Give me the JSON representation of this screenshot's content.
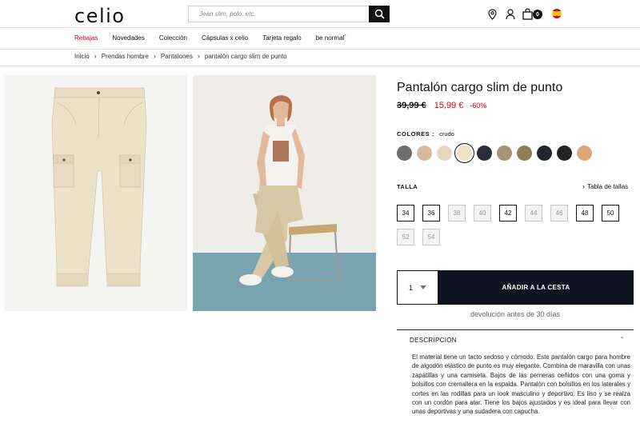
{
  "header": {
    "logo": "celio",
    "search_placeholder": "Jean slim, polo, etc.",
    "cart_count": "0"
  },
  "nav": {
    "items": [
      "Rebajas",
      "Novedades",
      "Colección",
      "Cápsulas x celio",
      "Tarjeta regalo",
      "be normal"
    ],
    "star": "*"
  },
  "breadcrumb": [
    "Inicio",
    "Prendas hombre",
    "Pantalones",
    "pantalón cargo slim de punto"
  ],
  "product": {
    "title": "Pantalón cargo slim de punto",
    "old_price": "39,99 €",
    "new_price": "15,99 €",
    "discount": "-60%",
    "colors_label": "COLORES :",
    "selected_color": "crudo",
    "swatch_colors": [
      "#6e6e6e",
      "#d6b99c",
      "#e8d7bf",
      "#ede4c8",
      "#2b2d3a",
      "#a89472",
      "#8d7f58",
      "#222530",
      "#242424",
      "#d8a878"
    ],
    "size_label": "TALLA",
    "size_guide": "Tabla de tallas",
    "sizes": [
      {
        "label": "34",
        "available": true
      },
      {
        "label": "36",
        "available": true
      },
      {
        "label": "38",
        "available": false
      },
      {
        "label": "40",
        "available": false
      },
      {
        "label": "42",
        "available": true
      },
      {
        "label": "44",
        "available": false
      },
      {
        "label": "46",
        "available": false
      },
      {
        "label": "48",
        "available": true
      },
      {
        "label": "50",
        "available": true
      },
      {
        "label": "52",
        "available": false
      },
      {
        "label": "54",
        "available": false
      }
    ],
    "quantity": "1",
    "add_to_cart": "AÑADIR A LA CESTA",
    "return_note": "devolución antes de 30 días",
    "description_label": "DESCRIPCIÓN",
    "description_toggle": "-",
    "description": "El material tiene un tacto sedoso y cómodo. Este pantalón cargo para hombre de algodón elástico de punto es muy elegante. Combina de maravilla con unas zapatillas y una camiseta. Bajos de las perneras ceñidos con una goma y bolsillos con cremallera en la espalda. Pantalón con bolsillos en los laterales y cortes en las rodillas para un look masculino y deportivo. Es liso y se realza con un cordón para atar. Tiene los bajos ajustados y es ideal para llevar con unas deportivas y una sudadera con capucha."
  }
}
